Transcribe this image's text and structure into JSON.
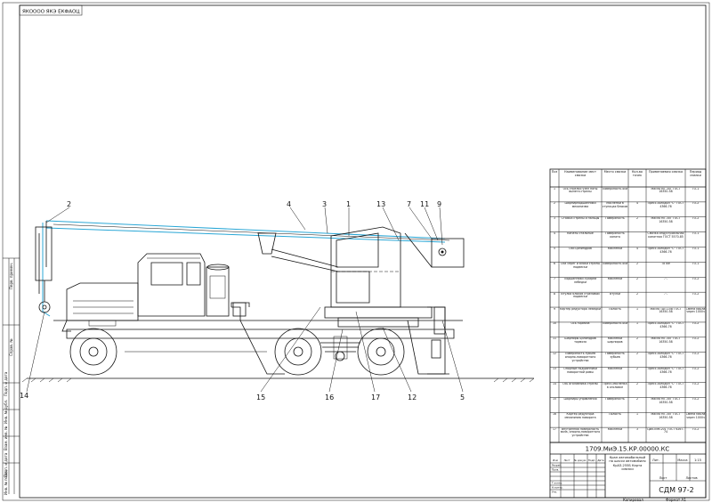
{
  "stamp_top": "ЯКОООО ЯКЭ ЕКФАОЦ",
  "callouts": [
    "1",
    "2",
    "3",
    "4",
    "5",
    "7",
    "9",
    "11",
    "12",
    "13",
    "14",
    "15",
    "16",
    "17"
  ],
  "table": {
    "headers": [
      "Поз",
      "Наименование мест смазки",
      "Место смазки",
      "Кол-во точек",
      "Применяемая смазка",
      "Период смазки"
    ],
    "rows": [
      [
        "1",
        "Ось стрелки узел пяты вылета стрелы",
        "Поверхность оси",
        "",
        "Масло МГ-30Т ГОСТ 16350-58",
        "ТО-1"
      ],
      [
        "2",
        "Шарнирподшипники механизма",
        "Масленки в ступицах блоков",
        "4",
        "Пресс-солидол \"С\" ГОСТ 4366-76",
        "ТО-2"
      ],
      [
        "3",
        "Стяжка стрелы и пальцы",
        "Поверхность",
        "2",
        "Масло МГ-30Т ГОСТ 16350-58",
        "ТО-2"
      ],
      [
        "4",
        "Канаты стальные",
        "Поверхность каната",
        "",
        "Смазка индустриальная канатная ГОСТ 5570-85",
        "ТО-1"
      ],
      [
        "5",
        "Оси цилиндров",
        "Масленки",
        "4",
        "Пресс-солидол \"С\" ГОСТ 4366-76",
        "ТО-1"
      ],
      [
        "6",
        "Оси серег и блоки стрелы подвески",
        "Поверхность оси",
        "2",
        "То же",
        "ТО-1"
      ],
      [
        "7",
        "Подшипники сухарей лебедки",
        "Масленки",
        "2",
        "-\"-",
        "ТО-2"
      ],
      [
        "8",
        "Втулки блоков стреловой подвески",
        "Втулки",
        "2",
        "-\"-",
        "ТО-2"
      ],
      [
        "9",
        "Картер редуктора лебедки",
        "Полость",
        "1",
        "Масло ТАП-15В ГОСТ 16350-58",
        "Смена масла через 1000ч"
      ],
      [
        "10",
        "Ось тормоза",
        "Поверхность оси",
        "1",
        "Пресс-солидол \"С\" ГОСТ 4366-76",
        "ТО-2"
      ],
      [
        "11",
        "Шарниры цилиндров тормоза",
        "Масленки шарниров",
        "2",
        "Масло МГ-30Т ГОСТ 16350-58",
        "ТО-2"
      ],
      [
        "12",
        "Поверхность зубьев опорно-поворотного устройства",
        "Поверхность зубьев",
        "2",
        "Пресс-солидол \"С\" ГОСТ 4366-76",
        "ТО-2"
      ],
      [
        "13",
        "Опорные подшипники поворотной рамы",
        "Масленки",
        "2",
        "Пресс-солидол \"С\" ГОСТ 4366-76",
        "ТО-2"
      ],
      [
        "14",
        "Ось оголовника стрелы",
        "Пресс-масленка в оголовке",
        "2",
        "Пресс-солидол \"С\" ГОСТ 4366-76",
        "ТО-2"
      ],
      [
        "15",
        "Шарниры управления",
        "Поверхность",
        "2",
        "Масло МГ-30Т ГОСТ 16350-58",
        "ТО-2"
      ],
      [
        "16",
        "Картер редуктора механизма поворота",
        "Полость",
        "1",
        "Масло МГ-30Т ГОСТ 16350-58",
        "Смена масла через 1000ч"
      ],
      [
        "17",
        "Внутренняя поверхность вала, опорно-поворотного устройства",
        "Масленки",
        "3",
        "ЦИАТИМ-201 ГОСТ 6267-74",
        "ТО-2"
      ]
    ]
  },
  "title_block": {
    "doc_code": "1709.МиЭ.15.КР.00000.КС",
    "title": "Кран автомобильный на шасси автомобиля КрАЗ-255Б Карта смазки",
    "org": "СДМ 97-2",
    "scale": "1:15",
    "sheet_label": "Лист",
    "sheets_label": "Листов",
    "mass_label": "Масса",
    "lit_label": "Лит.",
    "copied_label": "Копировал",
    "format_label": "Формат А1",
    "roles": [
      "Изм",
      "Лист",
      "№ докум.",
      "Подп.",
      "Дата",
      "Разраб.",
      "Пров.",
      "Т.контр.",
      "Н.контр.",
      "Утв."
    ]
  },
  "left_strip": [
    "Перв. примен.",
    "Справ. №",
    "Подп. и дата",
    "Инв. № дубл.",
    "Взам. инв. №",
    "Подп. и дата",
    "Инв. № подл."
  ]
}
